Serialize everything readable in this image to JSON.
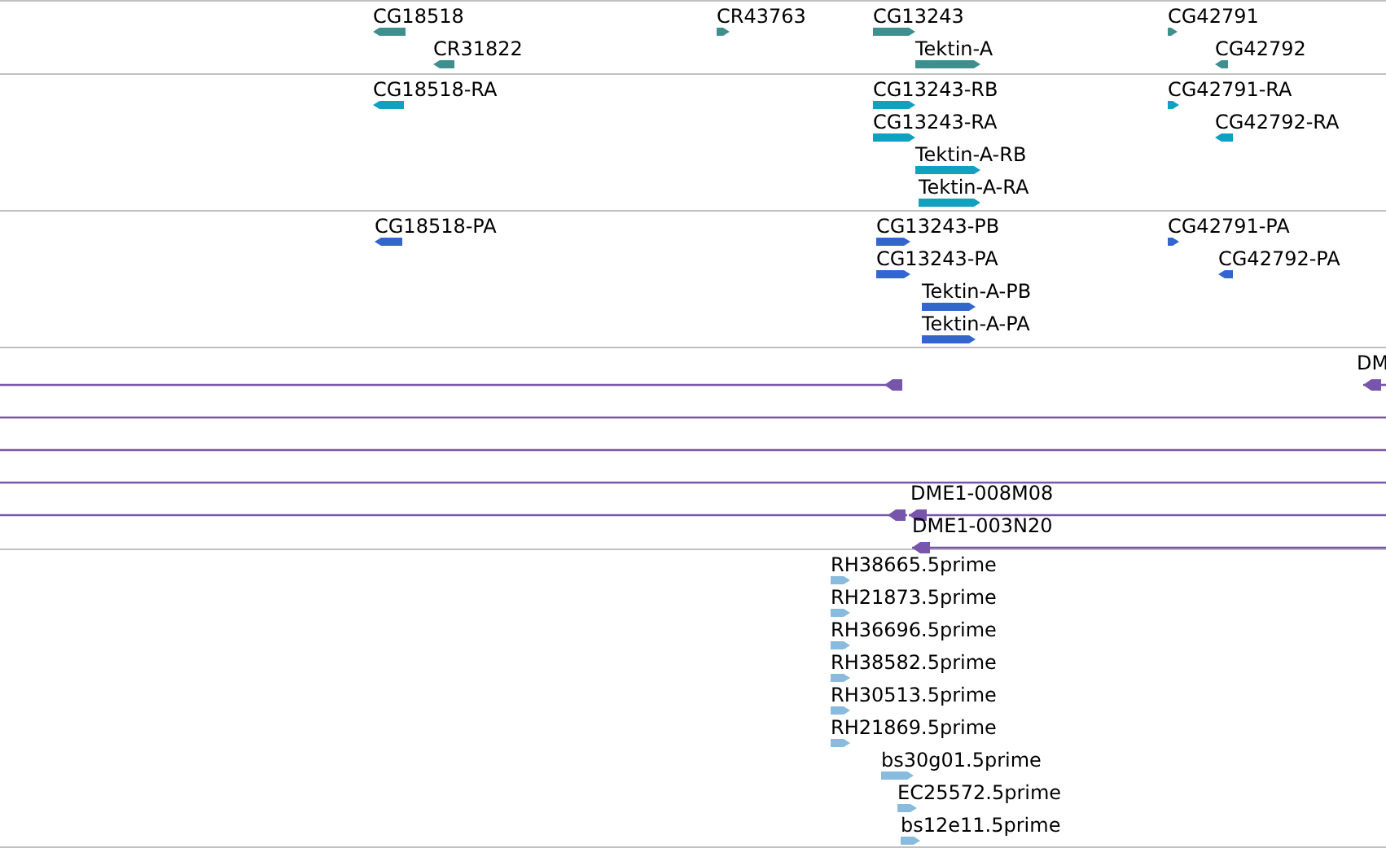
{
  "tracks": [
    {
      "kind": "gene",
      "color": "#3f8f8f",
      "features": [
        {
          "label": "CG18518",
          "reverse": true
        },
        {
          "label": "CR31822",
          "reverse": true
        },
        {
          "label": "CR43763",
          "reverse": false
        },
        {
          "label": "CG13243",
          "reverse": false
        },
        {
          "label": "Tektin-A",
          "reverse": false
        },
        {
          "label": "CG42791",
          "reverse": false
        },
        {
          "label": "CG42792",
          "reverse": true
        }
      ]
    },
    {
      "kind": "gene",
      "color": "#10a0c0",
      "features": [
        {
          "label": "CG18518-RA",
          "reverse": true
        },
        {
          "label": "CG13243-RB",
          "reverse": false
        },
        {
          "label": "CG13243-RA",
          "reverse": false
        },
        {
          "label": "Tektin-A-RB",
          "reverse": false
        },
        {
          "label": "Tektin-A-RA",
          "reverse": false
        },
        {
          "label": "CG42791-RA",
          "reverse": false
        },
        {
          "label": "CG42792-RA",
          "reverse": true
        }
      ]
    },
    {
      "kind": "gene",
      "color": "#3366cc",
      "features": [
        {
          "label": "CG18518-PA",
          "reverse": true
        },
        {
          "label": "CG13243-PB",
          "reverse": false
        },
        {
          "label": "CG13243-PA",
          "reverse": false
        },
        {
          "label": "Tektin-A-PB",
          "reverse": false
        },
        {
          "label": "Tektin-A-PA",
          "reverse": false
        },
        {
          "label": "CG42791-PA",
          "reverse": false
        },
        {
          "label": "CG42792-PA",
          "reverse": true
        }
      ]
    },
    {
      "kind": "clone",
      "color": "#7755aa",
      "features": [
        {
          "reverse": true
        },
        {
          "label": "DM",
          "reverse": true
        },
        {
          "reverse": true
        },
        {
          "label": "DME1-008M08",
          "reverse": true
        },
        {
          "label": "DME1-003N20",
          "reverse": true
        }
      ]
    },
    {
      "kind": "est",
      "color": "#88bbdd",
      "features": [
        {
          "label": "RH38665.5prime",
          "reverse": false
        },
        {
          "label": "RH21873.5prime",
          "reverse": false
        },
        {
          "label": "RH36696.5prime",
          "reverse": false
        },
        {
          "label": "RH38582.5prime",
          "reverse": false
        },
        {
          "label": "RH30513.5prime",
          "reverse": false
        },
        {
          "label": "RH21869.5prime",
          "reverse": false
        },
        {
          "label": "bs30g01.5prime",
          "reverse": false
        },
        {
          "label": "EC25572.5prime",
          "reverse": false
        },
        {
          "label": "bs12e11.5prime",
          "reverse": false
        }
      ]
    }
  ]
}
